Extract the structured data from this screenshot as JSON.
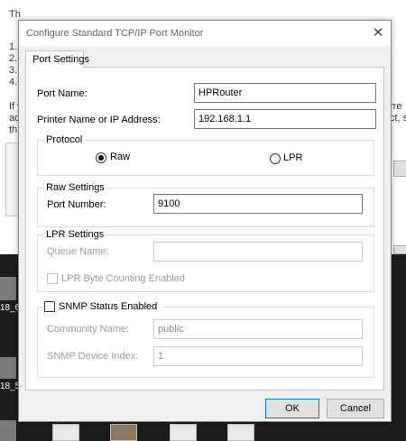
{
  "background_window": {
    "line1": "Th",
    "items": [
      "1.",
      "2.",
      "3.",
      "4."
    ],
    "para_line1": "If y",
    "para_line2": "ad",
    "para_line3": "th",
    "right_line1": "rre",
    "right_line2": "ct, s"
  },
  "desktop": {
    "labels": [
      "18_6",
      "18_5"
    ]
  },
  "dialog": {
    "title": "Configure Standard TCP/IP Port Monitor",
    "close_glyph": "✕",
    "tab_label": "Port Settings",
    "port_name_label": "Port Name:",
    "port_name_value": "HPRouter",
    "printer_label": "Printer Name or IP Address:",
    "printer_value": "192.168.1.1",
    "protocol": {
      "legend": "Protocol",
      "raw_label": "Raw",
      "lpr_label": "LPR",
      "selected": "Raw"
    },
    "raw_settings": {
      "legend": "Raw Settings",
      "port_number_label": "Port Number:",
      "port_number_value": "9100"
    },
    "lpr_settings": {
      "legend": "LPR Settings",
      "queue_name_label": "Queue Name:",
      "queue_name_value": "",
      "byte_counting_label": "LPR Byte Counting Enabled",
      "byte_counting_checked": false
    },
    "snmp": {
      "enabled_label": "SNMP Status Enabled",
      "enabled_checked": false,
      "community_label": "Community Name:",
      "community_value": "public",
      "device_index_label": "SNMP Device Index:",
      "device_index_value": "1"
    },
    "ok_label": "OK",
    "cancel_label": "Cancel"
  }
}
